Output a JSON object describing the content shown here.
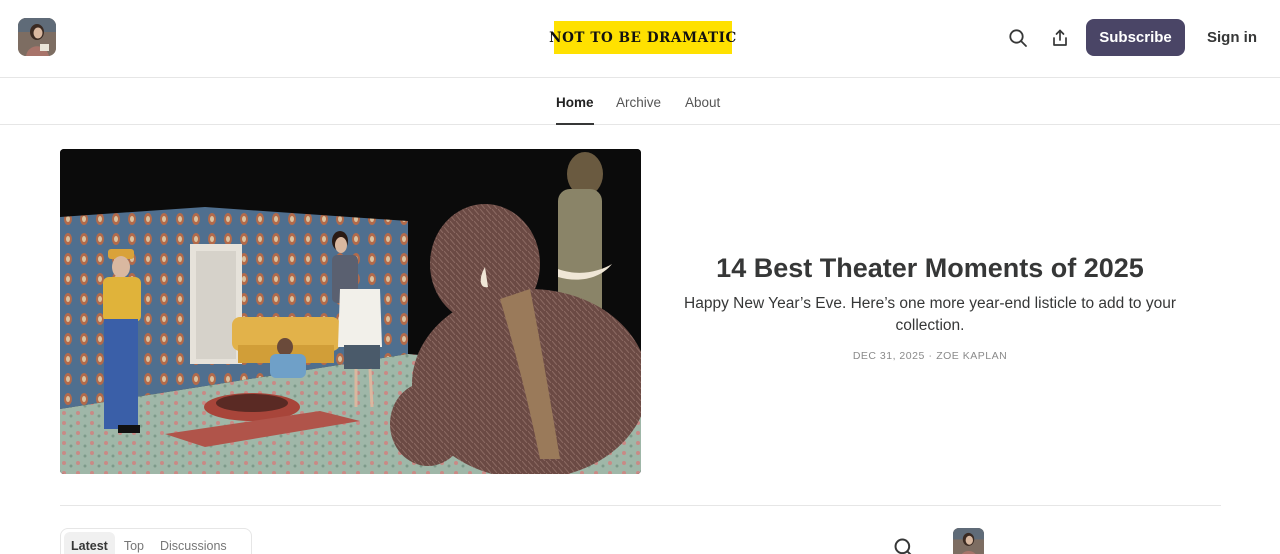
{
  "header": {
    "publication_logo_text": "NOT TO BE DRAMATIC",
    "logo_color": "#ffe100",
    "subscribe_label": "Subscribe",
    "signin_label": "Sign in",
    "subscribe_color": "#4a4566",
    "icons": [
      "avatar",
      "search-icon",
      "share-icon"
    ]
  },
  "nav": {
    "items": [
      {
        "label": "Home",
        "active": true
      },
      {
        "label": "Archive",
        "active": false
      },
      {
        "label": "About",
        "active": false
      }
    ]
  },
  "hero": {
    "title": "14 Best Theater Moments of 2025",
    "subtitle": "Happy New Year’s Eve. Here’s one more year-end listicle to add to your collection.",
    "date": "DEC 31, 2025",
    "separator": "∙",
    "author": "ZOE KAPLAN"
  },
  "feed": {
    "tabs": [
      {
        "label": "Latest",
        "active": true
      },
      {
        "label": "Top",
        "active": false
      },
      {
        "label": "Discussions",
        "active": false
      }
    ]
  }
}
